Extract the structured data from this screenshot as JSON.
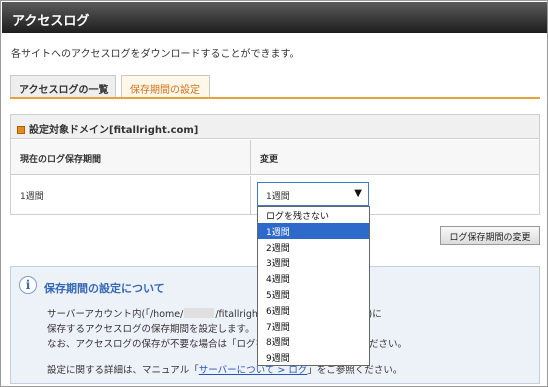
{
  "window": {
    "title": "アクセスログ"
  },
  "description": "各サイトへのアクセスログをダウンロードすることができます。",
  "tabs": [
    {
      "label": "アクセスログの一覧",
      "active": false
    },
    {
      "label": "保存期間の設定",
      "active": true
    }
  ],
  "panel": {
    "heading": "設定対象ドメイン[fitallright.com]",
    "columns": {
      "current": "現在のログ保存期間",
      "change": "変更"
    },
    "current_value": "1週間",
    "select": {
      "value": "1週間",
      "options": [
        "ログを残さない",
        "1週間",
        "2週間",
        "3週間",
        "4週間",
        "5週間",
        "6週間",
        "7週間",
        "8週間",
        "9週間"
      ],
      "highlighted_index": 1
    }
  },
  "change_button": "ログ保存期間の変更",
  "info": {
    "title": "保存期間の設定について",
    "line1a": "サーバーアカウント内(「/home/",
    "line1b": "/fitallright.com/log」ディレクトリ)に",
    "line2": "保存するアクセスログの保存期間を設定します。",
    "line3": "なお、アクセスログの保存が不要な場合は「ログを残さない」を選択してください。",
    "line4a": "設定に関する詳細は、マニュアル「",
    "line4_link": "サーバーについて > ログ",
    "line4b": "」をご参照ください。"
  },
  "colors": {
    "accent_orange": "#d0731e",
    "link_blue": "#2356b8",
    "select_blue": "#2d6ac9"
  }
}
